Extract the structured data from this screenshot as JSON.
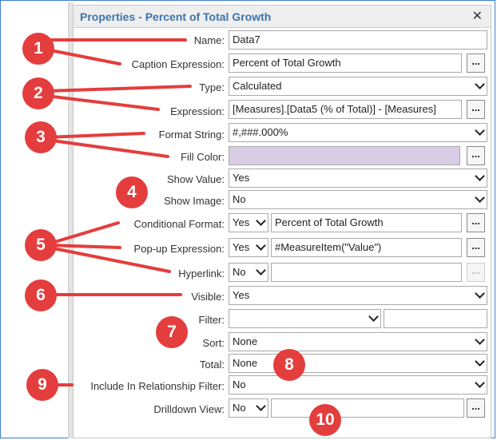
{
  "dialog": {
    "title": "Properties - Percent of Total Growth",
    "close_glyph": "✕"
  },
  "browse_label": "...",
  "fields": {
    "name": {
      "label": "Name:",
      "value": "Data7"
    },
    "caption": {
      "label": "Caption Expression:",
      "value": "Percent of Total Growth"
    },
    "type": {
      "label": "Type:",
      "value": "Calculated"
    },
    "expression": {
      "label": "Expression:",
      "value": "[Measures].[Data5 (% of Total)] - [Measures]"
    },
    "format_string": {
      "label": "Format String:",
      "value": "#,###.000%"
    },
    "fill_color": {
      "label": "Fill Color:",
      "value": "#d9cde5"
    },
    "show_value": {
      "label": "Show Value:",
      "value": "Yes"
    },
    "show_image": {
      "label": "Show Image:",
      "value": "No"
    },
    "conditional_format": {
      "label": "Conditional Format:",
      "flag": "Yes",
      "value": "Percent of Total Growth"
    },
    "popup_expression": {
      "label": "Pop-up Expression:",
      "flag": "Yes",
      "value": "#MeasureItem(\"Value\")"
    },
    "hyperlink": {
      "label": "Hyperlink:",
      "flag": "No",
      "value": ""
    },
    "visible": {
      "label": "Visible:",
      "value": "Yes"
    },
    "filter": {
      "label": "Filter:",
      "value": "",
      "text": ""
    },
    "sort": {
      "label": "Sort:",
      "value": "None"
    },
    "total": {
      "label": "Total:",
      "value": "None"
    },
    "include_relationship_filter": {
      "label": "Include In Relationship Filter:",
      "value": "No"
    },
    "drilldown_view": {
      "label": "Drilldown View:",
      "flag": "No",
      "value": ""
    }
  },
  "callouts": [
    "1",
    "2",
    "3",
    "4",
    "5",
    "6",
    "7",
    "8",
    "9",
    "10"
  ],
  "colors": {
    "callout": "#e43d3d",
    "title": "#3a74b0",
    "frame": "#3d7fc9"
  }
}
